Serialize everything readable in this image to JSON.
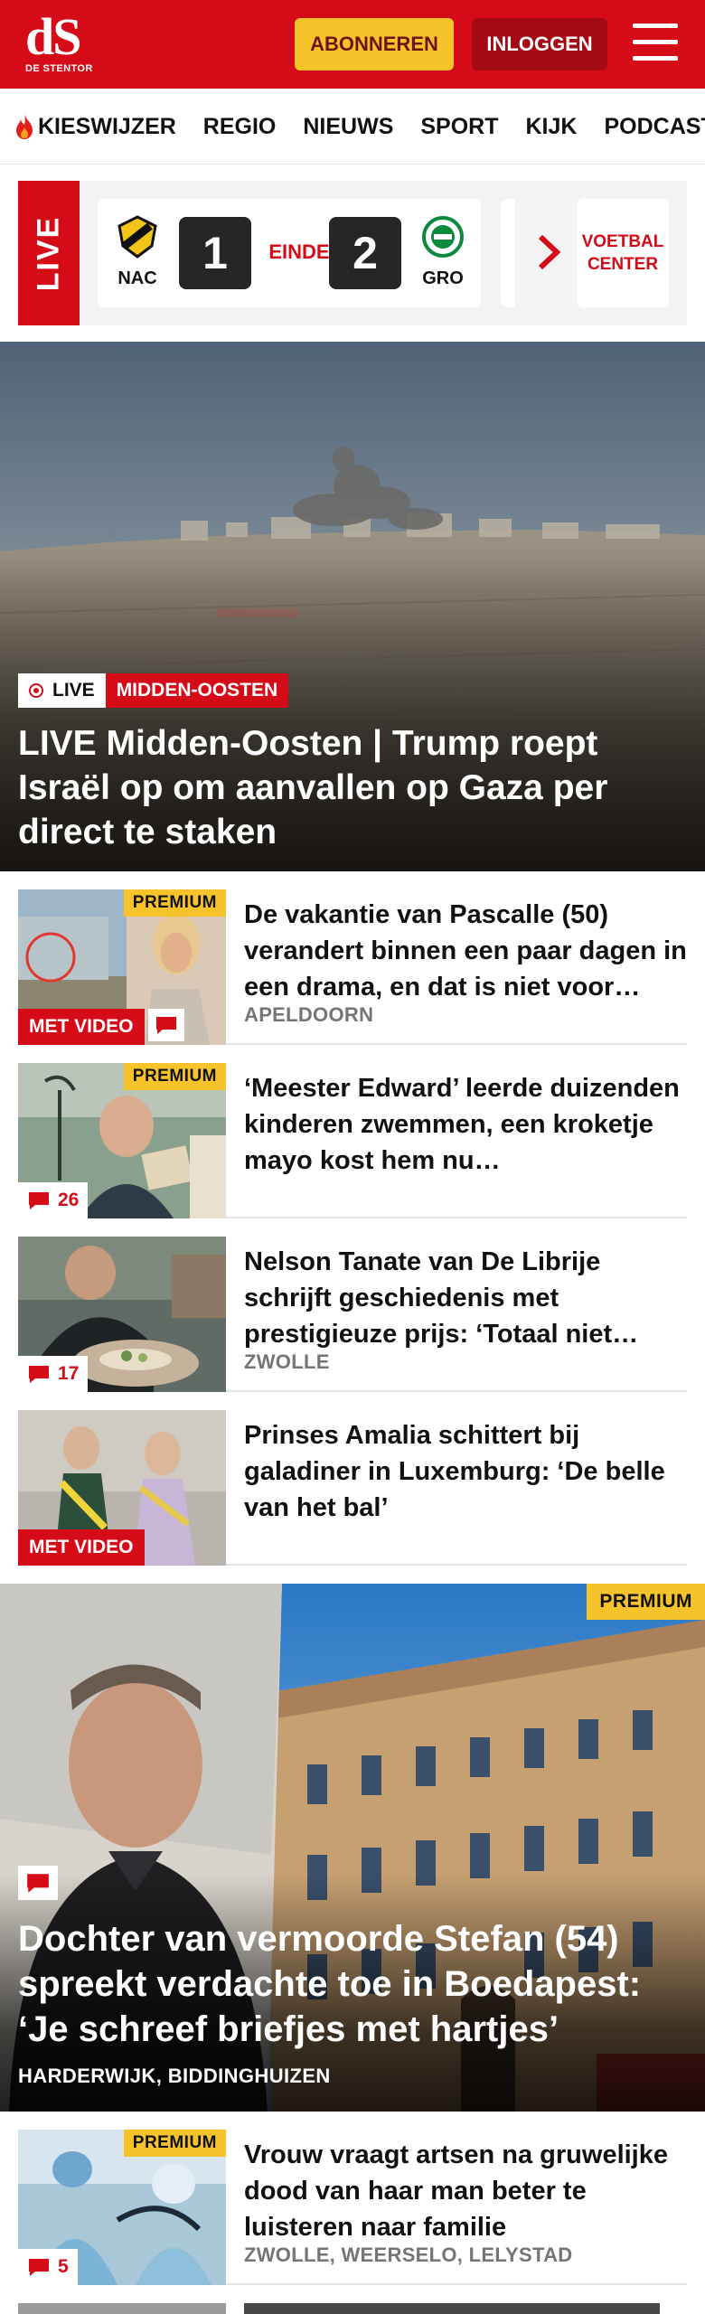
{
  "header": {
    "logo_mark": "dS",
    "logo_name": "DE STENTOR",
    "subscribe_label": "ABONNEREN",
    "login_label": "INLOGGEN",
    "colors": {
      "brand_red": "#d50c18",
      "accent_yellow": "#f7c32b",
      "dark_red": "#a40a14"
    }
  },
  "nav": {
    "items": [
      "KIESWIJZER",
      "REGIO",
      "NIEUWS",
      "SPORT",
      "KIJK",
      "PODCASTS"
    ]
  },
  "live_score": {
    "live_label": "LIVE",
    "home_team": "NAC",
    "home_score": "1",
    "status": "EINDE",
    "away_score": "2",
    "away_team": "GRO",
    "center_label": "VOETBAL CENTER"
  },
  "hero": {
    "live_label": "LIVE",
    "category": "MIDDEN-OOSTEN",
    "title": "LIVE Midden-Oosten | Trump roept Israël op om aanvallen op Gaza per direct te staken"
  },
  "articles": [
    {
      "title": "De vakantie van Pascalle (50) verandert binnen een paar dagen in een drama, en dat is niet voor…",
      "location": "APELDOORN",
      "premium": "PREMIUM",
      "video": "MET VIDEO"
    },
    {
      "title": "‘Meester Edward’ leerde duizenden kinderen zwemmen, een kroketje mayo kost hem nu…",
      "premium": "PREMIUM",
      "comments": "26"
    },
    {
      "title": "Nelson Tanate van De Librije schrijft geschiedenis met prestigieuze prijs: ‘Totaal niet…",
      "location": "ZWOLLE",
      "comments": "17"
    },
    {
      "title": "Prinses Amalia schittert bij galadiner in Luxemburg: ‘De belle van het bal’",
      "video": "MET VIDEO"
    }
  ],
  "feature": {
    "premium": "PREMIUM",
    "title": "Dochter van vermoorde Stefan (54) spreekt verdachte toe in Boedapest: ‘Je schreef briefjes met hartjes’",
    "location": "HARDERWIJK, BIDDINGHUIZEN"
  },
  "article_after": {
    "title": "Vrouw vraagt artsen na gruwelijke dood van haar man beter te luisteren naar familie",
    "location": "ZWOLLE, WEERSELO, LELYSTAD",
    "premium": "PREMIUM",
    "comments": "5"
  },
  "icons": {
    "menu": "hamburger-icon",
    "flame": "flame-icon",
    "next": "chevron-right-icon",
    "comment": "comment-icon",
    "live_dot": "live-dot-icon"
  }
}
